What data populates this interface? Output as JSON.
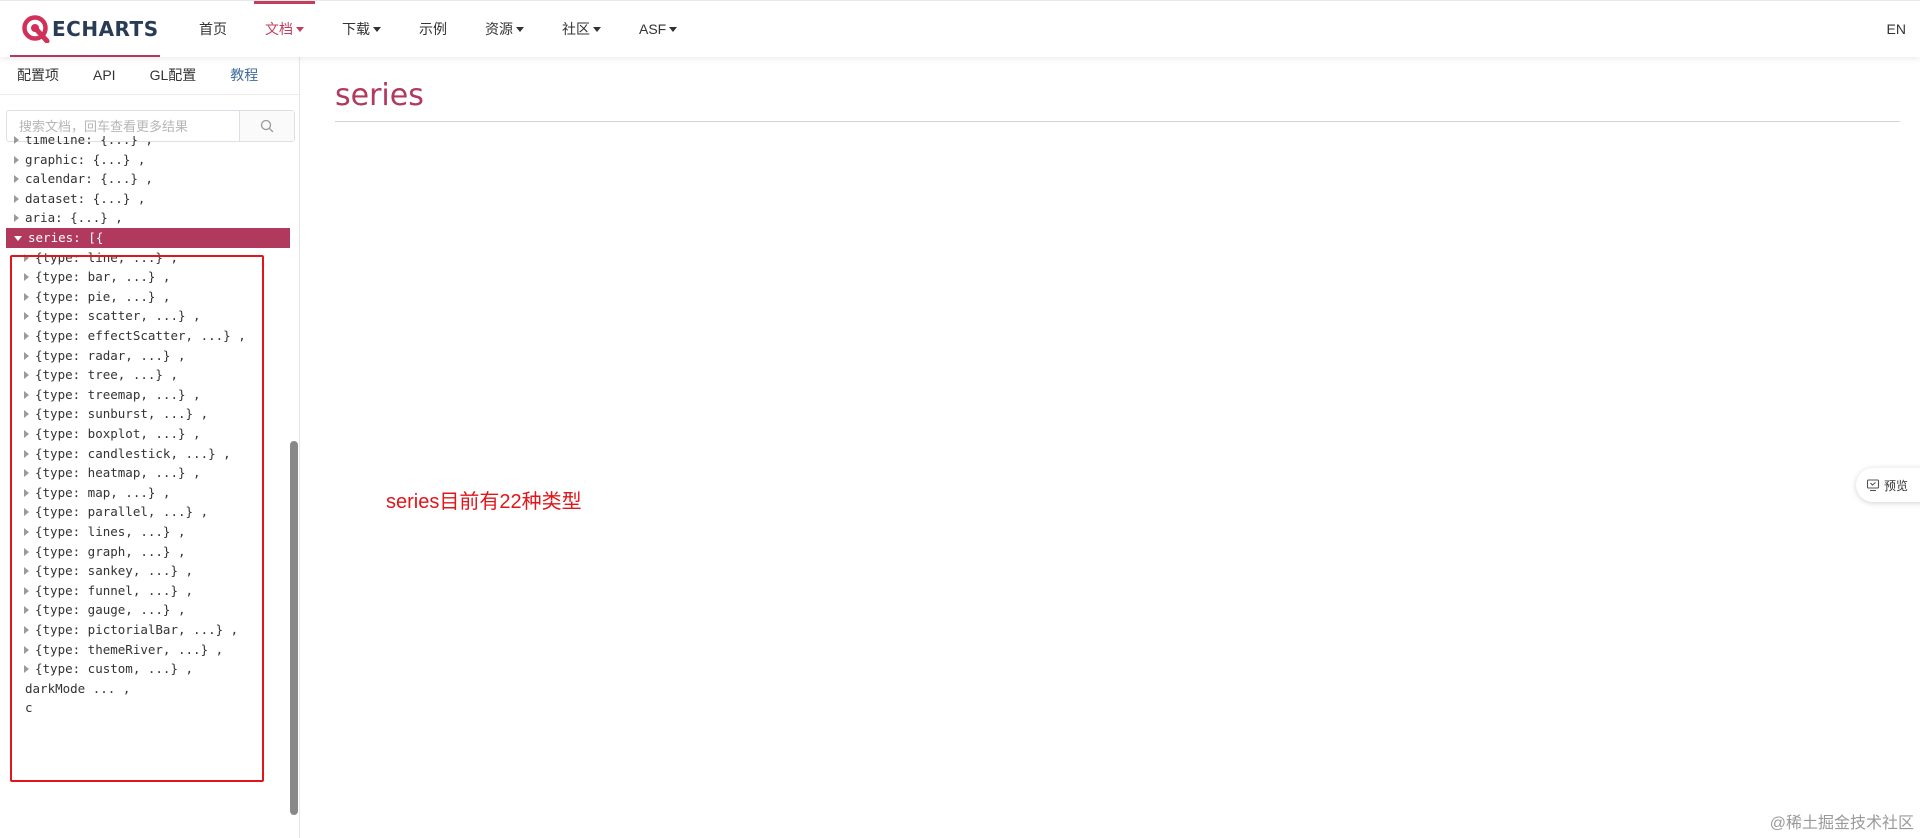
{
  "navbar": {
    "logo_text": "ECHARTS",
    "items": [
      {
        "label": "首页",
        "caret": false,
        "active": false
      },
      {
        "label": "文档",
        "caret": true,
        "active": true
      },
      {
        "label": "下载",
        "caret": true,
        "active": false
      },
      {
        "label": "示例",
        "caret": false,
        "active": false
      },
      {
        "label": "资源",
        "caret": true,
        "active": false
      },
      {
        "label": "社区",
        "caret": true,
        "active": false
      },
      {
        "label": "ASF",
        "caret": true,
        "active": false
      }
    ],
    "lang": "EN"
  },
  "sidebar": {
    "tabs": [
      "配置项",
      "API",
      "GL配置",
      "教程"
    ],
    "search": {
      "placeholder": "搜索文档，回车查看更多结果",
      "value": ""
    },
    "tree": [
      {
        "text": "timeline: {...} ,",
        "level": 0,
        "expander": "collapsed",
        "partial": true
      },
      {
        "text": "graphic: {...} ,",
        "level": 0,
        "expander": "collapsed"
      },
      {
        "text": "calendar: {...} ,",
        "level": 0,
        "expander": "collapsed"
      },
      {
        "text": "dataset: {...} ,",
        "level": 0,
        "expander": "collapsed"
      },
      {
        "text": "aria: {...} ,",
        "level": 0,
        "expander": "collapsed"
      },
      {
        "text": "series: [{",
        "level": 0,
        "expander": "expanded",
        "selected": true
      },
      {
        "text": "{type: line, ...} ,",
        "level": 1,
        "expander": "collapsed"
      },
      {
        "text": "{type: bar, ...} ,",
        "level": 1,
        "expander": "collapsed"
      },
      {
        "text": "{type: pie, ...} ,",
        "level": 1,
        "expander": "collapsed"
      },
      {
        "text": "{type: scatter, ...} ,",
        "level": 1,
        "expander": "collapsed"
      },
      {
        "text": "{type: effectScatter, ...} ,",
        "level": 1,
        "expander": "collapsed"
      },
      {
        "text": "{type: radar, ...} ,",
        "level": 1,
        "expander": "collapsed"
      },
      {
        "text": "{type: tree, ...} ,",
        "level": 1,
        "expander": "collapsed"
      },
      {
        "text": "{type: treemap, ...} ,",
        "level": 1,
        "expander": "collapsed"
      },
      {
        "text": "{type: sunburst, ...} ,",
        "level": 1,
        "expander": "collapsed"
      },
      {
        "text": "{type: boxplot, ...} ,",
        "level": 1,
        "expander": "collapsed"
      },
      {
        "text": "{type: candlestick, ...} ,",
        "level": 1,
        "expander": "collapsed"
      },
      {
        "text": "{type: heatmap, ...} ,",
        "level": 1,
        "expander": "collapsed"
      },
      {
        "text": "{type: map, ...} ,",
        "level": 1,
        "expander": "collapsed"
      },
      {
        "text": "{type: parallel, ...} ,",
        "level": 1,
        "expander": "collapsed"
      },
      {
        "text": "{type: lines, ...} ,",
        "level": 1,
        "expander": "collapsed"
      },
      {
        "text": "{type: graph, ...} ,",
        "level": 1,
        "expander": "collapsed"
      },
      {
        "text": "{type: sankey, ...} ,",
        "level": 1,
        "expander": "collapsed"
      },
      {
        "text": "{type: funnel, ...} ,",
        "level": 1,
        "expander": "collapsed"
      },
      {
        "text": "{type: gauge, ...} ,",
        "level": 1,
        "expander": "collapsed"
      },
      {
        "text": "{type: pictorialBar, ...} ,",
        "level": 1,
        "expander": "collapsed"
      },
      {
        "text": "{type: themeRiver, ...} ,",
        "level": 1,
        "expander": "collapsed"
      },
      {
        "text": "{type: custom, ...} ,",
        "level": 1,
        "expander": "collapsed"
      },
      {
        "text": "darkMode ... ,",
        "level": 0,
        "expander": "none"
      },
      {
        "text": "c",
        "level": 0,
        "expander": "none",
        "partial": true
      }
    ]
  },
  "main": {
    "title": "series",
    "annotation": "series目前有22种类型"
  },
  "preview_button": {
    "label": "预览",
    "icon": "preview-icon"
  },
  "watermark": "@稀土掘金技术社区",
  "colors": {
    "brand": "#b1395e",
    "nav_active": "#c23e5e",
    "annotation_red": "#e0161b",
    "logo_text": "#293c55",
    "tab_blue": "#3d6b9a"
  }
}
